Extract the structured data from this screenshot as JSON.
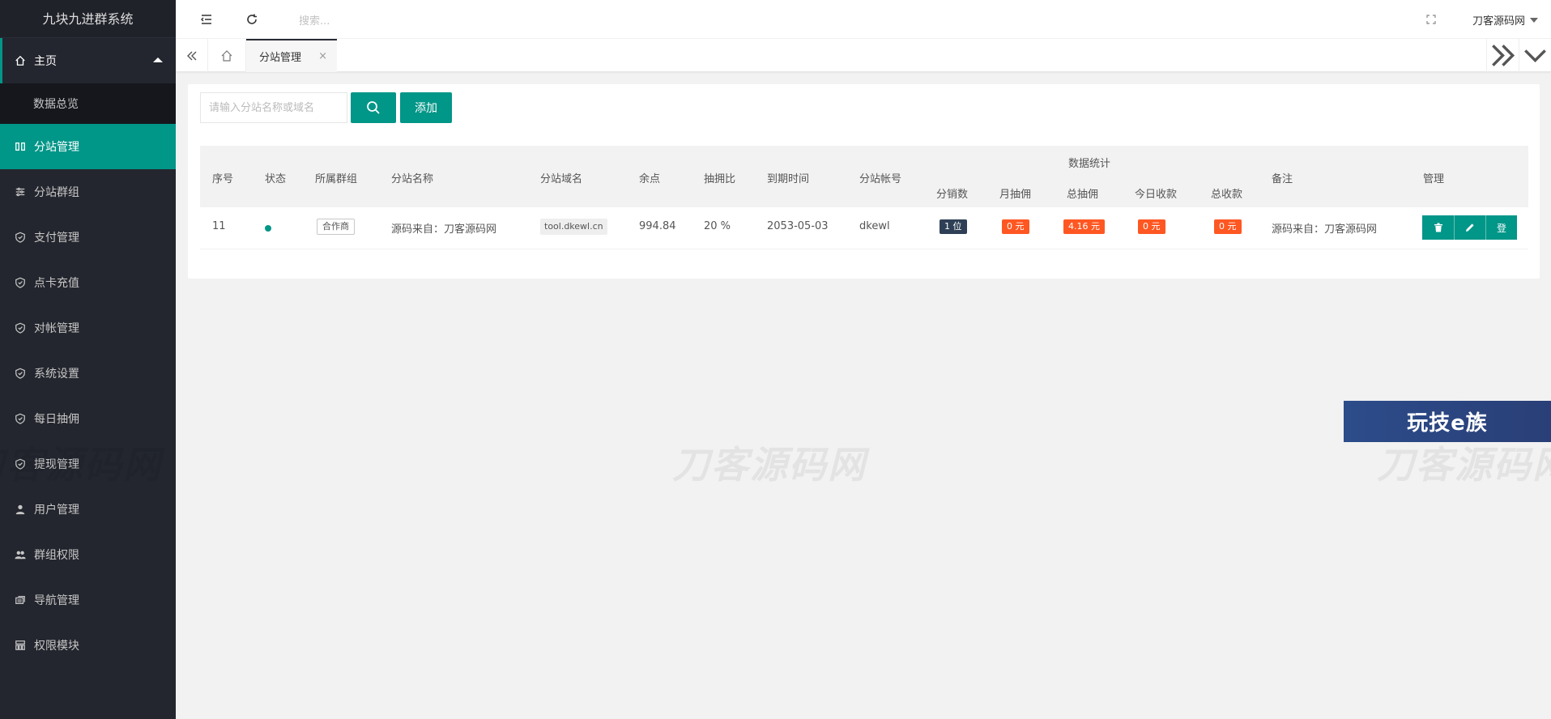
{
  "app": {
    "title": "九块九进群系统"
  },
  "sidebar": {
    "home": {
      "label": "主页",
      "sub": "数据总览"
    },
    "items": [
      {
        "label": "分站管理",
        "icon": "columns-icon",
        "active": true
      },
      {
        "label": "分站群组",
        "icon": "sliders-icon"
      },
      {
        "label": "支付管理",
        "icon": "shield-icon"
      },
      {
        "label": "点卡充值",
        "icon": "shield-icon"
      },
      {
        "label": "对帐管理",
        "icon": "shield-icon"
      },
      {
        "label": "系统设置",
        "icon": "shield-icon"
      },
      {
        "label": "每日抽佣",
        "icon": "shield-icon"
      },
      {
        "label": "提现管理",
        "icon": "shield-icon"
      },
      {
        "label": "用户管理",
        "icon": "user-icon"
      },
      {
        "label": "群组权限",
        "icon": "users-icon"
      },
      {
        "label": "导航管理",
        "icon": "nav-icon"
      },
      {
        "label": "权限模块",
        "icon": "modules-icon"
      }
    ]
  },
  "header": {
    "search_placeholder": "搜索...",
    "user": "刀客源码网"
  },
  "tabs": {
    "active_label": "分站管理",
    "close": "×"
  },
  "toolbar": {
    "search_placeholder": "请输入分站名称或域名",
    "add_label": "添加"
  },
  "table": {
    "headers": {
      "index": "序号",
      "status": "状态",
      "group": "所属群组",
      "name": "分站名称",
      "domain": "分站域名",
      "balance": "余点",
      "ratio": "抽拥比",
      "expire": "到期时间",
      "account": "分站帐号",
      "stats": "数据统计",
      "remark": "备注",
      "manage": "管理"
    },
    "stats_headers": {
      "dist": "分销数",
      "month_comm": "月抽佣",
      "total_comm": "总抽佣",
      "today_income": "今日收款",
      "total_income": "总收款"
    },
    "rows": [
      {
        "index": "11",
        "group": "合作商",
        "name": "源码来自：刀客源码网",
        "domain": "tool.dkewl.cn",
        "balance": "994.84",
        "ratio": "20 %",
        "expire": "2053-05-03",
        "account": "dkewl",
        "dist": "1 位",
        "month_comm": "0 元",
        "total_comm": "4.16 元",
        "today_income": "0 元",
        "total_income": "0 元",
        "remark": "源码来自：刀客源码网",
        "login": "登"
      }
    ]
  },
  "watermark": "刀客源码网",
  "promo": "玩技e族",
  "colors": {
    "accent": "#009688",
    "sidebar": "#23262e",
    "badge_dark": "#2f4056",
    "badge_orange": "#ff5722"
  }
}
